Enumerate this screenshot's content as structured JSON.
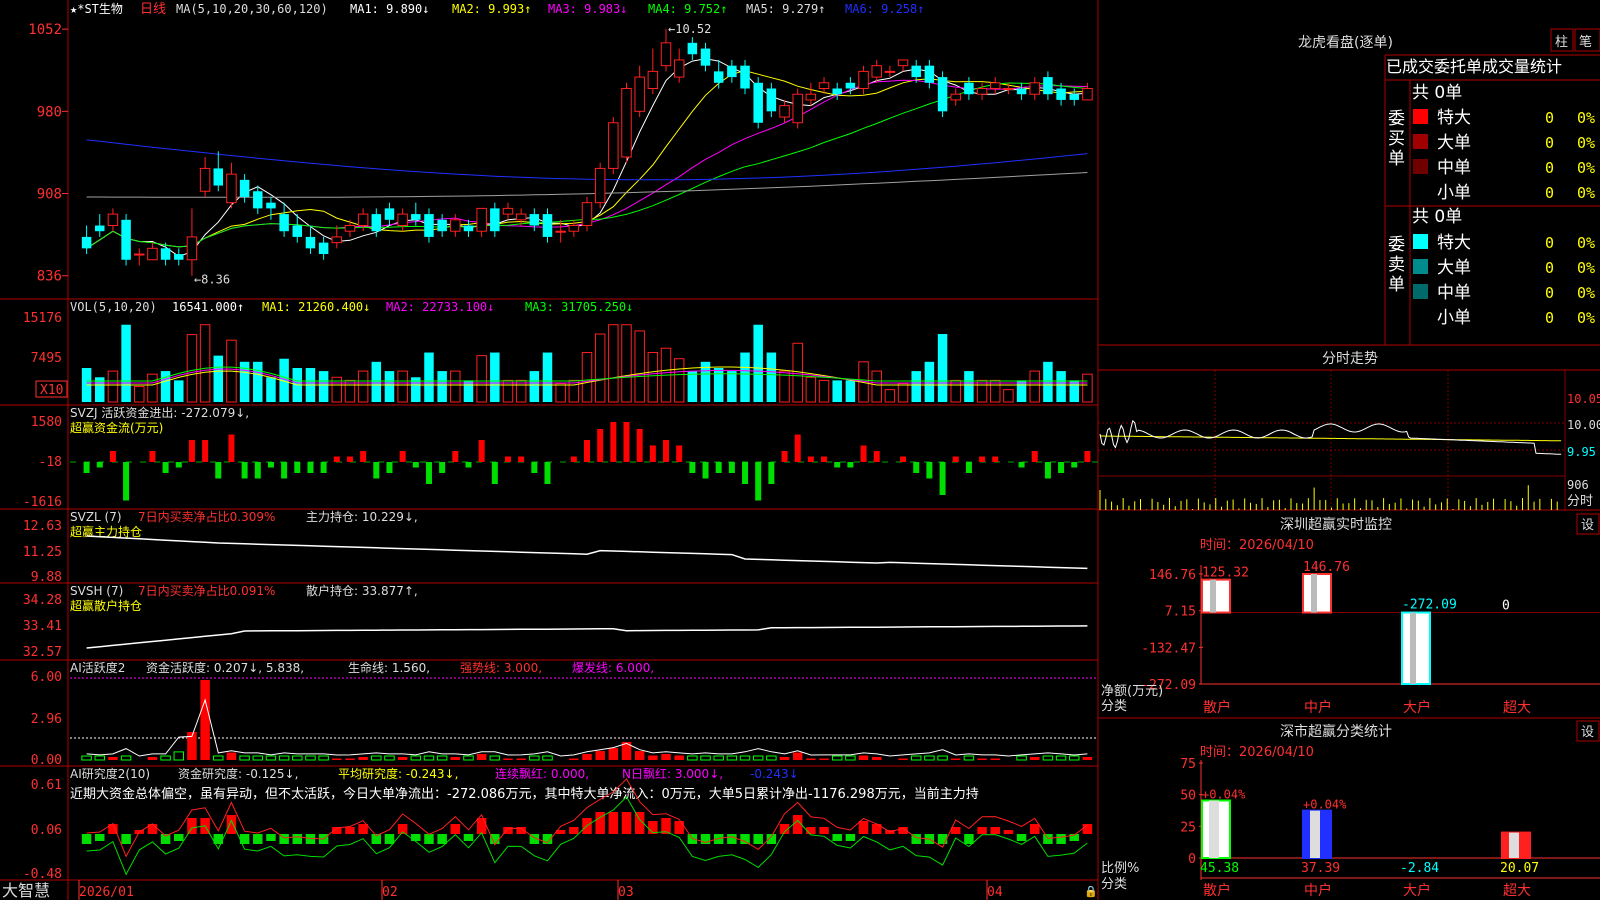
{
  "stock": {
    "name": "*ST生物",
    "period": "日线"
  },
  "colors": {
    "bg": "#000000",
    "border": "#b00000",
    "up": "#ff2020",
    "down": "#00ffff",
    "white": "#ffffff",
    "yellow": "#ffff00",
    "magenta": "#ff00ff",
    "green": "#00ff00",
    "blue": "#2030ff",
    "gray": "#a0a0a0",
    "grid": "#800000"
  },
  "main": {
    "header": {
      "prefix": "MA(5,10,20,30,60,120)",
      "ma1": "MA1: 9.890↓",
      "ma2": "MA2: 9.993↑",
      "ma3": "MA3: 9.983↓",
      "ma4": "MA4: 9.752↑",
      "ma5": "MA5: 9.279↑",
      "ma6": "MA6: 9.258↑"
    },
    "y_ticks": [
      "1052",
      "980",
      "908",
      "836"
    ],
    "high_label": "←10.52",
    "low_label": "←8.36"
  },
  "vol": {
    "header": {
      "name": "VOL(5,10,20)",
      "value": "16541.000↑",
      "ma1": "MA1: 21260.400↓",
      "ma2": "MA2: 22733.100↓",
      "ma3": "MA3: 31705.250↓"
    },
    "y_ticks": [
      "15176",
      "7495"
    ],
    "unit": "X10"
  },
  "svzj": {
    "line1": "SVZJ  活跃资金进出: -272.079↓,",
    "line2": "超赢资金流(万元)",
    "y_ticks": [
      "1580",
      "-18",
      "-1616"
    ]
  },
  "svzl": {
    "prefix": "SVZL (7)",
    "red": "7日内买卖净占比0.309%",
    "rest": "主力持仓: 10.229↓,",
    "line2": "超赢主力持仓",
    "y_ticks": [
      "12.63",
      "11.25",
      "9.88"
    ]
  },
  "svsh": {
    "prefix": "SVSH (7)",
    "red": "7日内买卖净占比0.091%",
    "rest": "散户持仓: 33.877↑,",
    "line2": "超赢散户持仓",
    "y_ticks": [
      "34.28",
      "33.41",
      "32.57"
    ]
  },
  "ai1": {
    "prefix": "AI活跃度2",
    "v1": "资金活跃度: 0.207↓, 5.838,",
    "v2": "生命线: 1.560,",
    "v3": "强势线: 3.000,",
    "v4": "爆发线: 6.000,",
    "y_ticks": [
      "6.00",
      "2.96",
      "0.00"
    ]
  },
  "ai2": {
    "prefix": "AI研究度2(10)",
    "v1": "资金研究度: -0.125↓,",
    "v2": "平均研究度: -0.243↓,",
    "v3": "连续飘红: 0.000,",
    "v4": "N日飘红: 3.000↓,",
    "v5": "-0.243↓",
    "comment": "近期大资金总体偏空，虽有异动，但不太活跃，今日大单净流出：-272.086万元，其中特大单净流入：0万元，大单5日累计净出-1176.298万元，当前主力持",
    "y_ticks": [
      "0.61",
      "0.06",
      "-0.48"
    ]
  },
  "bottom": {
    "brand": "大智慧",
    "dates": [
      "2026/01",
      "02",
      "03",
      "04"
    ]
  },
  "dragon": {
    "title": "龙虎看盘(逐单)",
    "btn1": "柱",
    "btn2": "笔",
    "tabs": [
      "已成交",
      "委托单",
      "成交量",
      "统计"
    ],
    "buy_label": "委买单",
    "sell_label": "委卖单",
    "buy": {
      "total": "共 0单",
      "rows": [
        {
          "name": "特大",
          "count": "0",
          "pct": "0%",
          "color": "#ff0000"
        },
        {
          "name": "大单",
          "count": "0",
          "pct": "0%",
          "color": "#a00000"
        },
        {
          "name": "中单",
          "count": "0",
          "pct": "0%",
          "color": "#700000"
        },
        {
          "name": "小单",
          "count": "0",
          "pct": "0%",
          "color": "#000000"
        }
      ]
    },
    "sell": {
      "total": "共 0单",
      "rows": [
        {
          "name": "特大",
          "count": "0",
          "pct": "0%",
          "color": "#00ffff"
        },
        {
          "name": "大单",
          "count": "0",
          "pct": "0%",
          "color": "#008c8c"
        },
        {
          "name": "中单",
          "count": "0",
          "pct": "0%",
          "color": "#006a6a"
        },
        {
          "name": "小单",
          "count": "0",
          "pct": "0%",
          "color": "#000000"
        }
      ]
    }
  },
  "intraday": {
    "title": "分时走势",
    "prices": [
      "10.05",
      "10.00",
      "9.95"
    ],
    "vol_label": "906",
    "caption": "分时"
  },
  "monitor": {
    "title": "深圳超赢实时监控",
    "setting": "设",
    "time": "时间：2026/04/10",
    "y_ticks": [
      "146.76",
      "7.15",
      "-132.47",
      "-272.09"
    ],
    "ylabel": "净额(万元)",
    "xlabel": "分类",
    "categories": [
      "散户",
      "中户",
      "大户",
      "超大"
    ],
    "values": [
      125.32,
      146.76,
      -272.09,
      0
    ],
    "value_labels": [
      "125.32",
      "146.76",
      "-272.09",
      "0"
    ]
  },
  "stats": {
    "title": "深市超赢分类统计",
    "setting": "设",
    "time": "时间：2026/04/10",
    "y_ticks": [
      "75",
      "50",
      "25",
      "0"
    ],
    "ylabel": "比例%",
    "xlabel": "分类",
    "categories": [
      "散户",
      "中户",
      "大户",
      "超大"
    ],
    "values": [
      45.38,
      37.39,
      -2.84,
      20.07
    ],
    "value_labels": [
      "45.38",
      "37.39",
      "-2.84",
      "20.07"
    ],
    "top_labels": [
      "+0.04%",
      "+0.04%",
      "",
      ""
    ]
  },
  "chart_data": [
    {
      "type": "candlestick",
      "title": "*ST生物 日线",
      "ylim": [
        8.2,
        10.6
      ],
      "x": [
        "2026/01",
        "",
        "",
        "",
        "",
        "",
        "",
        "",
        "",
        "",
        "",
        "",
        "",
        "",
        "",
        "",
        "",
        "",
        "",
        "",
        "02",
        "",
        "",
        "",
        "",
        "",
        "",
        "",
        "",
        "",
        "",
        "",
        "",
        "",
        "",
        "03",
        "",
        "",
        "",
        "",
        "",
        "",
        "",
        "",
        "",
        "",
        "",
        "",
        "",
        "",
        "",
        "",
        "",
        "",
        "",
        "",
        "",
        "",
        "",
        "",
        "",
        "",
        "",
        "",
        "",
        "",
        "",
        "",
        "",
        "",
        "",
        "",
        "",
        "",
        "",
        "04",
        "",
        "",
        "",
        "",
        "",
        "",
        ""
      ],
      "open": [
        8.7,
        8.8,
        8.8,
        8.85,
        8.55,
        8.5,
        8.6,
        8.55,
        8.5,
        9.1,
        9.3,
        9.0,
        9.2,
        9.1,
        9.0,
        8.9,
        8.8,
        8.7,
        8.65,
        8.65,
        8.75,
        8.8,
        8.9,
        8.95,
        8.8,
        8.9,
        8.9,
        8.85,
        8.75,
        8.8,
        8.75,
        8.95,
        8.9,
        8.85,
        8.9,
        8.9,
        8.75,
        8.75,
        8.8,
        9.0,
        9.3,
        9.4,
        9.8,
        10.0,
        10.2,
        10.1,
        10.4,
        10.35,
        10.15,
        10.2,
        10.2,
        10.05,
        10.0,
        9.75,
        9.7,
        9.9,
        10.0,
        10.0,
        10.05,
        10.0,
        10.1,
        10.15,
        10.2,
        10.2,
        10.2,
        10.1,
        9.9,
        10.05,
        9.95,
        10.0,
        10.0,
        10.0,
        9.95,
        10.1,
        10.0,
        9.95,
        9.9
      ],
      "close": [
        8.6,
        8.75,
        8.9,
        8.5,
        8.55,
        8.6,
        8.5,
        8.5,
        8.7,
        9.3,
        9.15,
        9.25,
        9.05,
        8.95,
        8.95,
        8.75,
        8.7,
        8.6,
        8.55,
        8.7,
        8.8,
        8.9,
        8.75,
        8.85,
        8.9,
        8.85,
        8.7,
        8.75,
        8.85,
        8.75,
        8.95,
        8.75,
        8.95,
        8.9,
        8.8,
        8.7,
        8.75,
        8.8,
        9.0,
        9.3,
        9.7,
        10.0,
        10.1,
        10.15,
        10.4,
        10.25,
        10.3,
        10.2,
        10.05,
        10.1,
        10.0,
        9.7,
        9.8,
        9.85,
        9.95,
        9.95,
        10.05,
        9.95,
        10.0,
        10.15,
        10.2,
        10.15,
        10.25,
        10.1,
        10.05,
        9.8,
        9.95,
        9.95,
        10.0,
        10.05,
        10.0,
        9.95,
        10.05,
        9.95,
        9.9,
        9.9,
        10.0
      ],
      "high": [
        8.8,
        8.9,
        8.95,
        8.9,
        8.6,
        8.65,
        8.65,
        8.6,
        8.95,
        9.4,
        9.45,
        9.35,
        9.25,
        9.15,
        9.05,
        9.0,
        8.9,
        8.8,
        8.7,
        8.8,
        8.85,
        8.95,
        8.95,
        9.0,
        8.95,
        9.0,
        8.95,
        8.9,
        8.9,
        8.85,
        8.95,
        9.0,
        9.0,
        8.95,
        8.95,
        8.95,
        8.85,
        8.85,
        9.05,
        9.35,
        9.75,
        10.05,
        10.2,
        10.35,
        10.52,
        10.35,
        10.45,
        10.4,
        10.25,
        10.25,
        10.25,
        10.1,
        10.05,
        9.9,
        10.0,
        10.05,
        10.1,
        10.05,
        10.1,
        10.2,
        10.25,
        10.2,
        10.25,
        10.25,
        10.25,
        10.15,
        10.0,
        10.1,
        10.05,
        10.1,
        10.05,
        10.05,
        10.1,
        10.15,
        10.05,
        10.0,
        10.05
      ],
      "low": [
        8.55,
        8.7,
        8.75,
        8.45,
        8.45,
        8.5,
        8.45,
        8.45,
        8.36,
        9.05,
        9.1,
        8.95,
        9.0,
        8.9,
        8.85,
        8.7,
        8.65,
        8.55,
        8.5,
        8.6,
        8.7,
        8.75,
        8.7,
        8.8,
        8.75,
        8.8,
        8.65,
        8.7,
        8.7,
        8.7,
        8.7,
        8.7,
        8.85,
        8.8,
        8.75,
        8.65,
        8.65,
        8.7,
        8.75,
        8.95,
        9.25,
        9.35,
        9.75,
        9.95,
        10.15,
        10.05,
        10.25,
        10.15,
        10.0,
        10.05,
        9.95,
        9.65,
        9.75,
        9.7,
        9.65,
        9.85,
        9.95,
        9.9,
        9.95,
        9.95,
        10.05,
        10.1,
        10.15,
        10.05,
        10.0,
        9.75,
        9.85,
        9.9,
        9.9,
        9.95,
        9.95,
        9.9,
        9.9,
        9.9,
        9.85,
        9.85,
        9.9
      ]
    },
    {
      "type": "bar",
      "title": "深圳超赢实时监控",
      "categories": [
        "散户",
        "中户",
        "大户",
        "超大"
      ],
      "values": [
        125.32,
        146.76,
        -272.09,
        0
      ],
      "ylabel": "净额(万元)",
      "xlabel": "分类"
    },
    {
      "type": "bar",
      "title": "深市超赢分类统计",
      "categories": [
        "散户",
        "中户",
        "大户",
        "超大"
      ],
      "values": [
        45.38,
        37.39,
        -2.84,
        20.07
      ],
      "ylabel": "比例%",
      "xlabel": "分类"
    }
  ]
}
